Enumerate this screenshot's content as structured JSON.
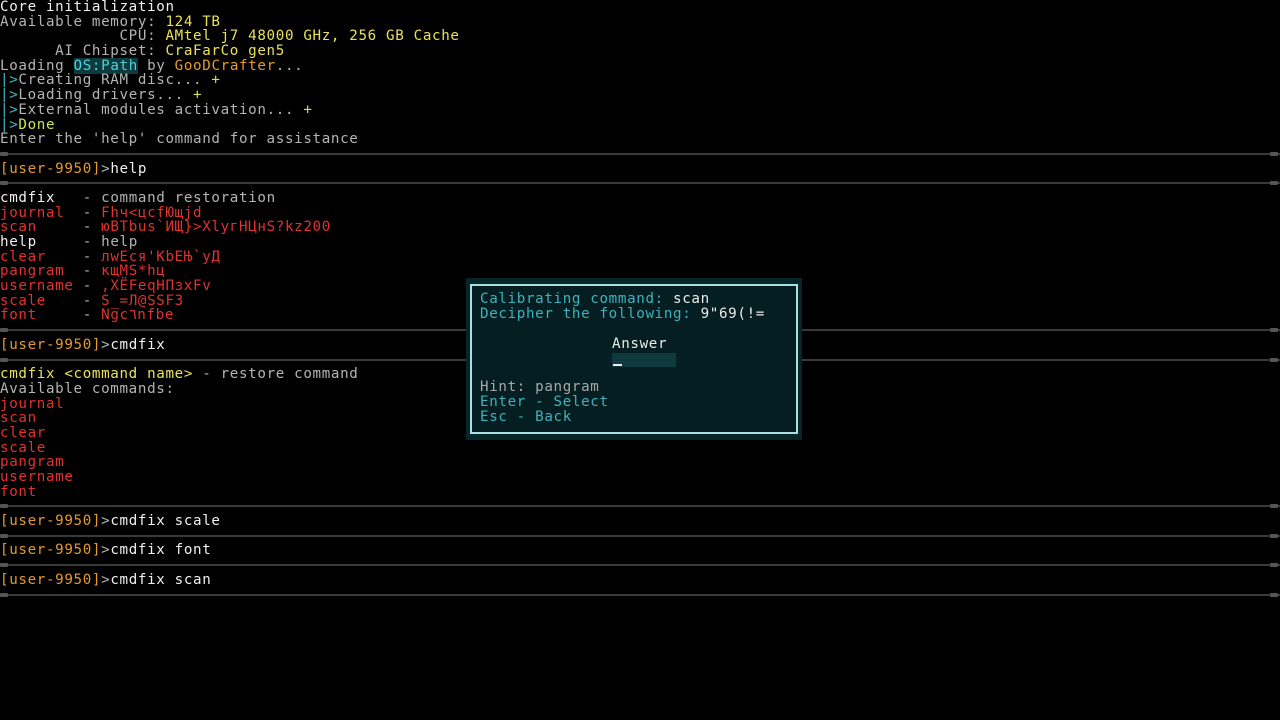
{
  "boot": {
    "title": "Core initialization",
    "memory_label": "Available memory: ",
    "memory_value": "124 TB",
    "cpu_label": "             CPU: ",
    "cpu_value": "AMtel j7 48000 GHz, 256 GB Cache",
    "chipset_label": "      AI Chipset: ",
    "chipset_value": "CraFarCo gen5",
    "loading_prefix": "Loading ",
    "os_name": "OS:Path",
    "loading_by": " by ",
    "author": "GooDCrafter",
    "loading_suffix": "...",
    "steps": [
      {
        "prefix": "|>",
        "text": "Creating RAM disc... ",
        "status": "+"
      },
      {
        "prefix": "|>",
        "text": "Loading drivers... ",
        "status": "+"
      },
      {
        "prefix": "|>",
        "text": "External modules activation... ",
        "status": "+"
      },
      {
        "prefix": "|>",
        "text": "Done",
        "status": ""
      }
    ],
    "help_hint": "Enter the 'help' command for assistance"
  },
  "prompt": "[user-9950]",
  "prompt_arrow": ">",
  "history": {
    "cmd_help": "help",
    "help_entries": [
      {
        "name": "cmdfix  ",
        "desc": "command restoration",
        "ok": true
      },
      {
        "name": "journal ",
        "desc": "Fhч<цcfЮщjd",
        "ok": false
      },
      {
        "name": "scan    ",
        "desc": "юBTbus`ИЩ}>XlyгHЦнS?kz200",
        "ok": false
      },
      {
        "name": "help    ",
        "desc": "help",
        "ok": true
      },
      {
        "name": "clear   ",
        "desc": "лwEcя'KbEЊ`yД",
        "ok": false
      },
      {
        "name": "pangram ",
        "desc": "кщMS*hц",
        "ok": false
      },
      {
        "name": "username",
        "desc": ",XЁFeqHПзxFv",
        "ok": false
      },
      {
        "name": "scale   ",
        "desc": "S_=Л@SSFЗ",
        "ok": false
      },
      {
        "name": "font    ",
        "desc": "Ngc٦nfbe",
        "ok": false
      }
    ],
    "help_dash": " - ",
    "cmd_cmdfix": "cmdfix",
    "cmdfix_usage_cmd": "cmdfix <command name>",
    "cmdfix_usage_desc": " - restore command",
    "available_label": "Available commands:",
    "available_commands": [
      "journal",
      "scan",
      "clear",
      "scale",
      "pangram",
      "username",
      "font"
    ],
    "cmd_scale": "cmdfix scale",
    "cmd_font": "cmdfix font",
    "cmd_scan": "cmdfix scan"
  },
  "dialog": {
    "calibrating_label": "Calibrating command: ",
    "calibrating_value": "scan",
    "decipher_label": "Decipher the following: ",
    "decipher_value": "9\"69(!=",
    "answer_label": "Answer",
    "answer_value": "",
    "hint": "Hint: pangram",
    "enter_hint": "Enter - Select",
    "esc_hint": "Esc - Back"
  }
}
